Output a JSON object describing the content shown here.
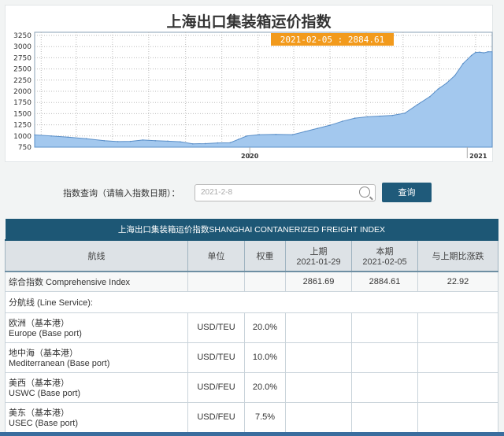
{
  "chart_data": {
    "type": "area",
    "title": "上海出口集装箱运价指数",
    "ylim": [
      750,
      3250
    ],
    "yticks": [
      750,
      1000,
      1250,
      1500,
      1750,
      2000,
      2250,
      2500,
      2750,
      3000,
      3250
    ],
    "xtick_labels": [
      "2020",
      "2021"
    ],
    "grid": true,
    "tooltip": "2021-02-05 : 2884.61",
    "x": [
      "2019-01-04",
      "2019-02-01",
      "2019-03-01",
      "2019-04-01",
      "2019-05-01",
      "2019-05-24",
      "2019-06-14",
      "2019-07-05",
      "2019-07-26",
      "2019-08-16",
      "2019-09-06",
      "2019-09-27",
      "2019-10-18",
      "2019-11-08",
      "2019-11-29",
      "2019-12-13",
      "2019-12-27",
      "2020-01-17",
      "2020-02-14",
      "2020-03-13",
      "2020-04-03",
      "2020-04-24",
      "2020-05-15",
      "2020-06-05",
      "2020-06-26",
      "2020-07-17",
      "2020-08-07",
      "2020-08-28",
      "2020-09-18",
      "2020-10-09",
      "2020-10-30",
      "2020-11-13",
      "2020-11-27",
      "2020-12-11",
      "2020-12-25",
      "2021-01-08",
      "2021-01-15",
      "2021-01-22",
      "2021-01-29",
      "2021-02-05"
    ],
    "values": [
      1025,
      1000,
      975,
      940,
      895,
      875,
      880,
      910,
      895,
      885,
      870,
      825,
      830,
      845,
      850,
      925,
      1000,
      1030,
      1035,
      1030,
      1100,
      1170,
      1240,
      1330,
      1400,
      1430,
      1445,
      1460,
      1510,
      1700,
      1880,
      2050,
      2180,
      2350,
      2620,
      2800,
      2870,
      2875,
      2861.69,
      2884.61
    ]
  },
  "query": {
    "label": "指数查询（请输入指数日期）：",
    "placeholder": "2021-2-8",
    "button": "查询"
  },
  "table": {
    "caption": "上海出口集装箱运价指数SHANGHAI CONTANERIZED FREIGHT INDEX",
    "headers": {
      "route": "航线",
      "unit": "单位",
      "weight": "权重",
      "prev_label": "上期",
      "prev_date": "2021-01-29",
      "curr_label": "本期",
      "curr_date": "2021-02-05",
      "change": "与上期比涨跌"
    },
    "comprehensive": {
      "name": "综合指数 Comprehensive Index",
      "prev": "2861.69",
      "curr": "2884.61",
      "change": "22.92"
    },
    "line_service": "分航线 (Line Service):",
    "rows": [
      {
        "cn": "欧洲（基本港）",
        "en": "Europe (Base port)",
        "unit": "USD/TEU",
        "weight": "20.0%"
      },
      {
        "cn": "地中海（基本港）",
        "en": "Mediterranean (Base port)",
        "unit": "USD/TEU",
        "weight": "10.0%"
      },
      {
        "cn": "美西（基本港）",
        "en": "USWC (Base port)",
        "unit": "USD/FEU",
        "weight": "20.0%"
      },
      {
        "cn": "美东（基本港）",
        "en": "USEC (Base port)",
        "unit": "USD/FEU",
        "weight": "7.5%"
      }
    ]
  }
}
